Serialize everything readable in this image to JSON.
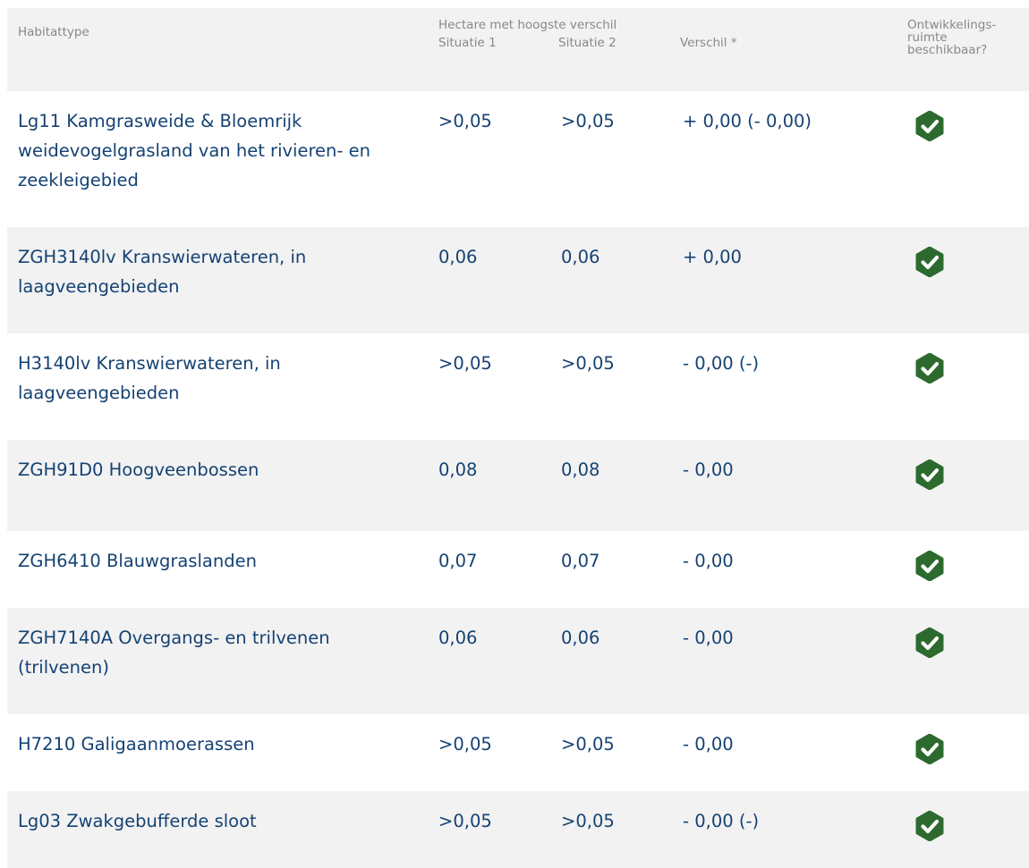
{
  "header": {
    "habitattype": "Habitattype",
    "hectare": "Hectare met hoogste verschil",
    "situatie1": "Situatie 1",
    "situatie2": "Situatie 2",
    "verschil": "Verschil *",
    "ontwikkelingsruimte": "Ontwikkelings-\nruimte\nbeschikbaar?"
  },
  "rows": [
    {
      "name": "Lg11 Kamgrasweide & Bloemrijk weidevogelgrasland van het rivieren- en zeekleigebied",
      "s1": ">0,05",
      "s2": ">0,05",
      "diff": "+ 0,00 (- 0,00)",
      "available": true
    },
    {
      "name": "ZGH3140lv Kranswierwateren, in laagveengebieden",
      "s1": "0,06",
      "s2": "0,06",
      "diff": "+ 0,00",
      "available": true
    },
    {
      "name": "H3140lv Kranswierwateren, in laagveengebieden",
      "s1": ">0,05",
      "s2": ">0,05",
      "diff": "- 0,00 (-)",
      "available": true
    },
    {
      "name": "ZGH91D0 Hoogveenbossen",
      "s1": "0,08",
      "s2": "0,08",
      "diff": "- 0,00",
      "available": true
    },
    {
      "name": "ZGH6410 Blauwgraslanden",
      "s1": "0,07",
      "s2": "0,07",
      "diff": "- 0,00",
      "available": true
    },
    {
      "name": "ZGH7140A Overgangs- en trilvenen (trilvenen)",
      "s1": "0,06",
      "s2": "0,06",
      "diff": "- 0,00",
      "available": true
    },
    {
      "name": "H7210 Galigaanmoerassen",
      "s1": ">0,05",
      "s2": ">0,05",
      "diff": "- 0,00",
      "available": true
    },
    {
      "name": "Lg03 Zwakgebufferde sloot",
      "s1": ">0,05",
      "s2": ">0,05",
      "diff": "- 0,00 (-)",
      "available": true
    }
  ],
  "colors": {
    "text": "#154273",
    "header_text": "#888888",
    "row_alt_bg": "#f2f2f2",
    "check": "#2d6a2e"
  },
  "icons": {
    "available": "check-circle-icon"
  }
}
